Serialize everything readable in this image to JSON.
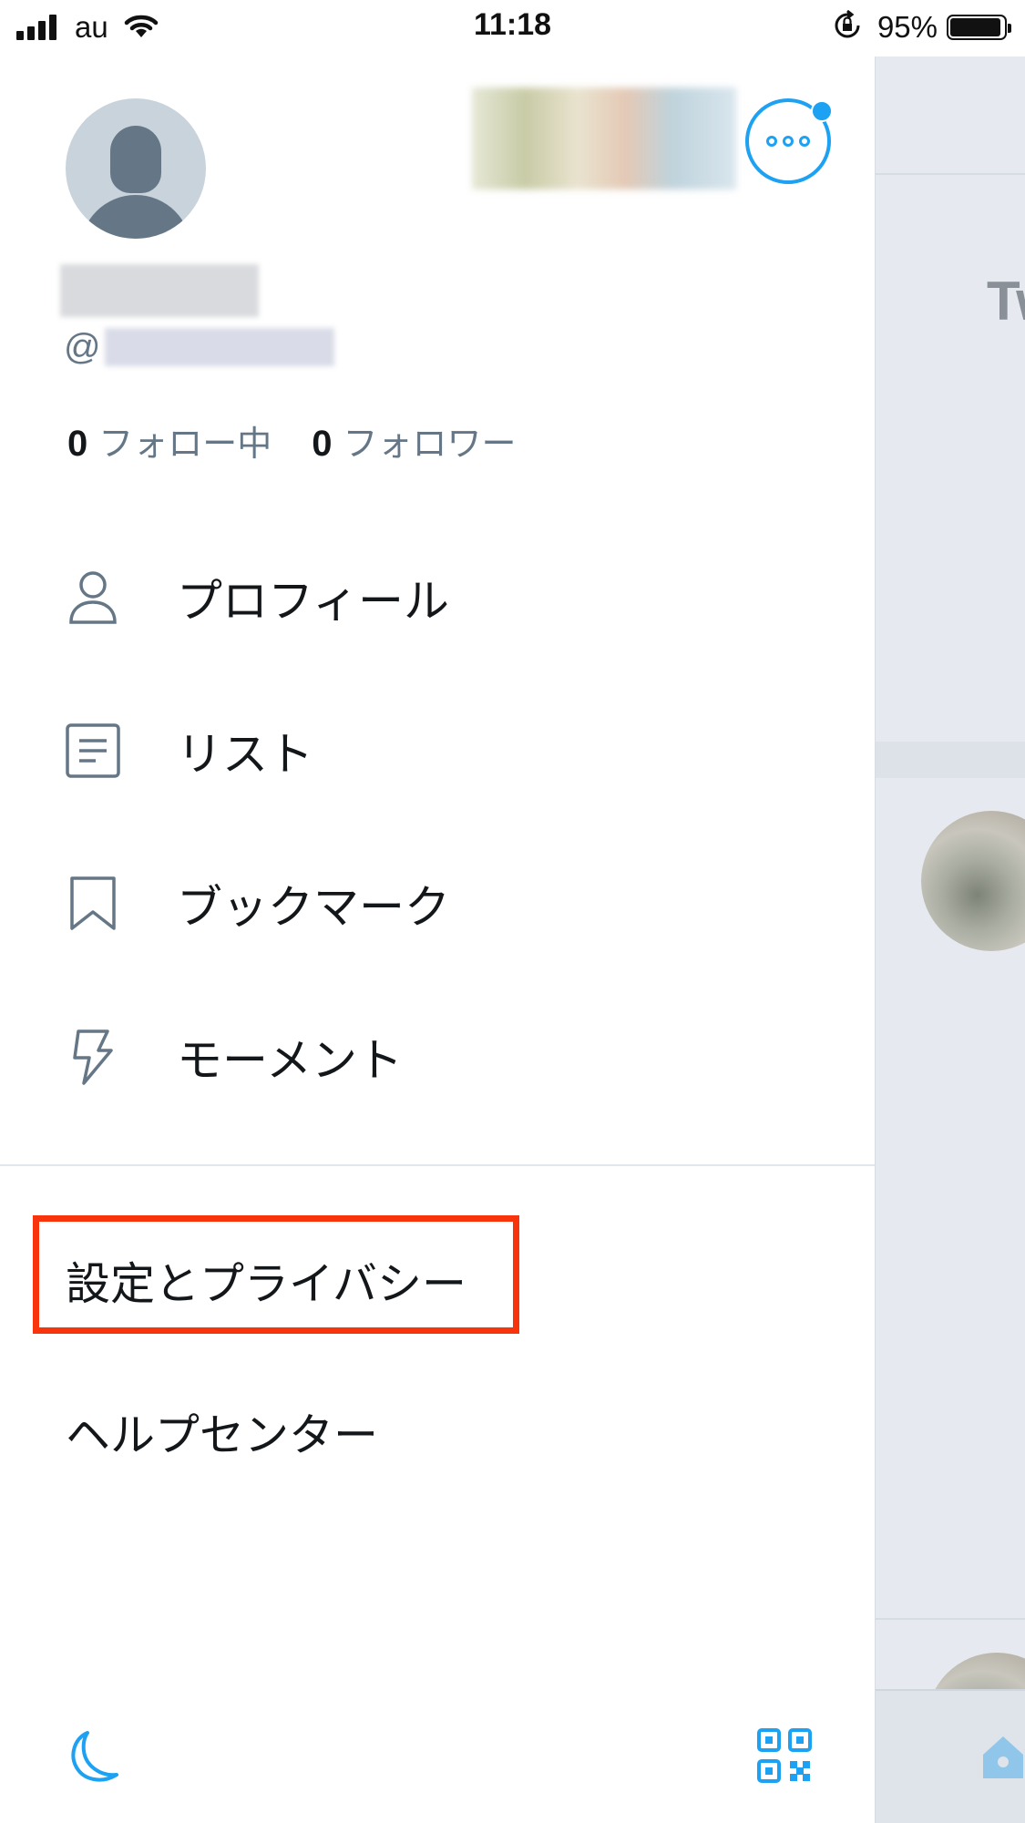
{
  "status_bar": {
    "carrier": "au",
    "time": "11:18",
    "battery_percent": "95%",
    "battery_level": 0.95,
    "icons": [
      "signal-icon",
      "wifi-icon",
      "orientation-lock-icon",
      "battery-icon"
    ]
  },
  "profile": {
    "handle_prefix": "@",
    "following_count": "0",
    "following_label": "フォロー中",
    "followers_count": "0",
    "followers_label": "フォロワー",
    "unread_badge": true
  },
  "menu": {
    "items": [
      {
        "label": "プロフィール",
        "icon": "person-icon"
      },
      {
        "label": "リスト",
        "icon": "list-icon"
      },
      {
        "label": "ブックマーク",
        "icon": "bookmark-icon"
      },
      {
        "label": "モーメント",
        "icon": "lightning-icon"
      }
    ],
    "settings_label": "設定とプライバシー",
    "help_label": "ヘルプセンター"
  },
  "background_feed": {
    "header_text": "Tw"
  },
  "bottom": {
    "icons": [
      "night-mode-icon",
      "qr-code-icon"
    ]
  },
  "colors": {
    "accent": "#1da1f2",
    "text_primary": "#14171a",
    "text_secondary": "#657786",
    "icon_gray": "#657786",
    "highlight": "#f7340c"
  }
}
